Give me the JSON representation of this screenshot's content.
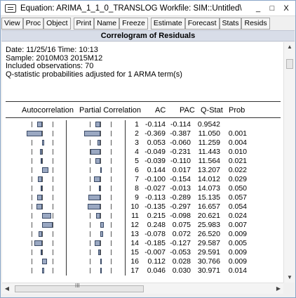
{
  "window": {
    "title": "Equation: ARIMA_1_1_0_TRANSLOG   Workfile: SIM::Untitled\\",
    "controls": [
      "_",
      "□",
      "X"
    ]
  },
  "toolbar": {
    "group1": [
      "View",
      "Proc",
      "Object"
    ],
    "group2": [
      "Print",
      "Name",
      "Freeze"
    ],
    "group3": [
      "Estimate",
      "Forecast",
      "Stats",
      "Resids"
    ]
  },
  "caption": "Correlogram of Residuals",
  "header": {
    "line1": "Date: 11/25/16   Time: 10:13",
    "line2": "Sample: 2010M03 2015M12",
    "line3": "Included observations: 70",
    "line4": "Q-statistic probabilities adjusted for 1 ARMA term(s)"
  },
  "columns": {
    "autocorrelation": "Autocorrelation",
    "partial_correlation": "Partial Correlation",
    "ac": "AC",
    "pac": "PAC",
    "qstat": "Q-Stat",
    "prob": "Prob"
  },
  "rows": [
    {
      "lag": "1",
      "ac": "-0.114",
      "pac": "-0.114",
      "q": "0.9542",
      "p": ""
    },
    {
      "lag": "2",
      "ac": "-0.369",
      "pac": "-0.387",
      "q": "11.050",
      "p": "0.001"
    },
    {
      "lag": "3",
      "ac": "0.053",
      "pac": "-0.060",
      "q": "11.259",
      "p": "0.004"
    },
    {
      "lag": "4",
      "ac": "-0.049",
      "pac": "-0.231",
      "q": "11.443",
      "p": "0.010"
    },
    {
      "lag": "5",
      "ac": "-0.039",
      "pac": "-0.110",
      "q": "11.564",
      "p": "0.021"
    },
    {
      "lag": "6",
      "ac": "0.144",
      "pac": "0.017",
      "q": "13.207",
      "p": "0.022"
    },
    {
      "lag": "7",
      "ac": "-0.100",
      "pac": "-0.154",
      "q": "14.012",
      "p": "0.029"
    },
    {
      "lag": "8",
      "ac": "-0.027",
      "pac": "-0.013",
      "q": "14.073",
      "p": "0.050"
    },
    {
      "lag": "9",
      "ac": "-0.113",
      "pac": "-0.289",
      "q": "15.135",
      "p": "0.057"
    },
    {
      "lag": "10",
      "ac": "-0.135",
      "pac": "-0.297",
      "q": "16.657",
      "p": "0.054"
    },
    {
      "lag": "11",
      "ac": "0.215",
      "pac": "-0.098",
      "q": "20.621",
      "p": "0.024"
    },
    {
      "lag": "12",
      "ac": "0.248",
      "pac": "0.075",
      "q": "25.983",
      "p": "0.007"
    },
    {
      "lag": "13",
      "ac": "-0.078",
      "pac": "0.072",
      "q": "26.520",
      "p": "0.009"
    },
    {
      "lag": "14",
      "ac": "-0.185",
      "pac": "-0.127",
      "q": "29.587",
      "p": "0.005"
    },
    {
      "lag": "15",
      "ac": "-0.007",
      "pac": "-0.053",
      "q": "29.591",
      "p": "0.009"
    },
    {
      "lag": "16",
      "ac": "0.112",
      "pac": "0.028",
      "q": "30.766",
      "p": "0.009"
    },
    {
      "lag": "17",
      "ac": "0.046",
      "pac": "0.030",
      "q": "30.971",
      "p": "0.014"
    }
  ],
  "scrollbar": {
    "h_grip": "III"
  },
  "colors": {
    "bar_fill": "#9aa8c2",
    "bar_border": "#3a4a66",
    "caption_bg": "#d8dde8"
  }
}
